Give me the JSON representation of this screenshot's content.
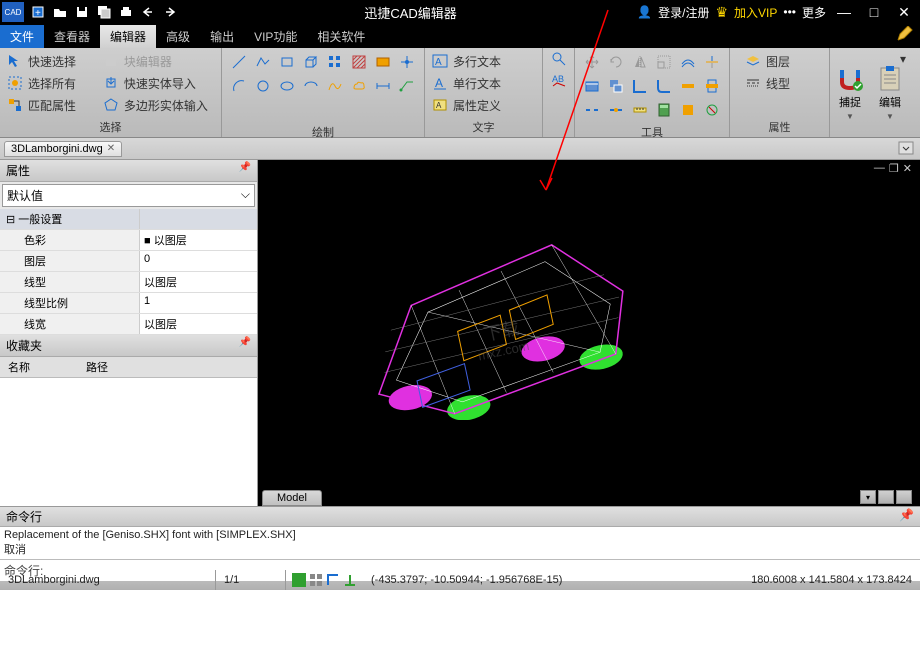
{
  "titlebar": {
    "title": "迅捷CAD编辑器",
    "login": "登录/注册",
    "vip": "加入VIP",
    "more": "更多"
  },
  "menubar": {
    "file": "文件",
    "viewer": "查看器",
    "editor": "编辑器",
    "advanced": "高级",
    "output": "输出",
    "vipfunc": "VIP功能",
    "related": "相关软件"
  },
  "ribbon": {
    "select": {
      "quick": "快速选择",
      "all": "选择所有",
      "match": "匹配属性",
      "blockedit": "块编辑器",
      "fastsolid": "快速实体导入",
      "polysolid": "多边形实体输入",
      "label": "选择"
    },
    "draw": {
      "label": "绘制"
    },
    "text": {
      "multi": "多行文本",
      "single": "单行文本",
      "attrdef": "属性定义",
      "label": "文字"
    },
    "tools": {
      "label": "工具"
    },
    "attr": {
      "layer": "图层",
      "linetype": "线型",
      "label": "属性"
    },
    "snap": "捕捉",
    "edit": "编辑"
  },
  "filetab": {
    "name": "3DLamborgini.dwg"
  },
  "properties": {
    "title": "属性",
    "default": "默认值",
    "cat1": "一般设置",
    "rows": {
      "color": "色彩",
      "color_v": "■ 以图层",
      "layer": "图层",
      "layer_v": "0",
      "linetype": "线型",
      "linetype_v": "以图层",
      "linescale": "线型比例",
      "linescale_v": "1",
      "linewidth": "线宽",
      "linewidth_v": "以图层"
    },
    "favorites": "收藏夹",
    "name_col": "名称",
    "path_col": "路径"
  },
  "model_tab": "Model",
  "command": {
    "title": "命令行",
    "line1": "Replacement of the [Geniso.SHX] font with [SIMPLEX.SHX]",
    "line2": "取消",
    "prompt": "命令行:"
  },
  "statusbar": {
    "file": "3DLamborgini.dwg",
    "page": "1/1",
    "coords": "(-435.3797; -10.50944; -1.956768E-15)",
    "dims": "180.6008 x 141.5804 x 173.8424"
  }
}
